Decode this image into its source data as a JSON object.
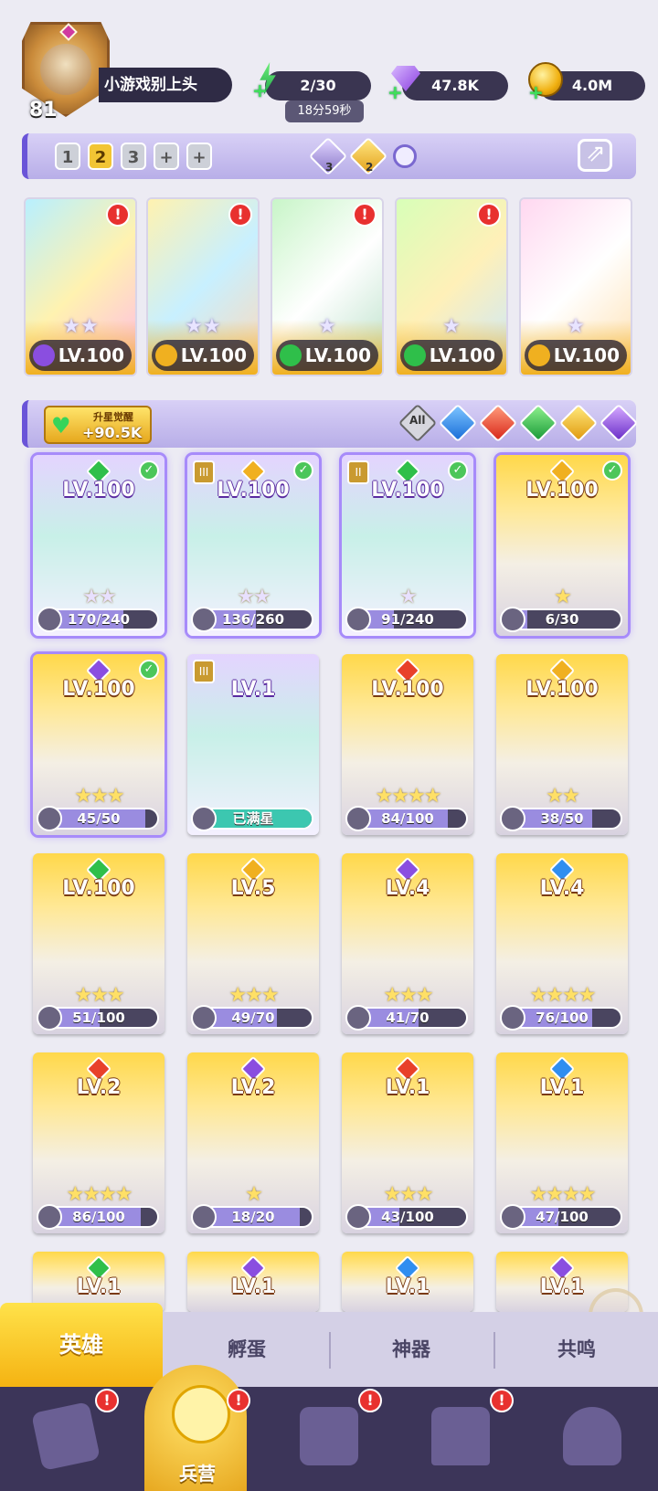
{
  "player": {
    "level": "81",
    "name": "小游戏别上头"
  },
  "resources": {
    "energy": "2/30",
    "energy_timer": "18分59秒",
    "gems": "47.8K",
    "gold": "4.0M"
  },
  "team": {
    "tabs": [
      "1",
      "2",
      "3",
      "+",
      "+"
    ],
    "active_tab": "2",
    "element_counts": [
      {
        "icon": "water-element-icon",
        "count": "3"
      },
      {
        "icon": "light-element-icon",
        "count": "2"
      }
    ],
    "members": [
      {
        "level": "LV.100",
        "element": "moon",
        "stars": 2,
        "alert": true
      },
      {
        "level": "LV.100",
        "element": "light",
        "stars": 2,
        "alert": true
      },
      {
        "level": "LV.100",
        "element": "nature",
        "stars": 1,
        "alert": true
      },
      {
        "level": "LV.100",
        "element": "nature",
        "stars": 1,
        "alert": true
      },
      {
        "level": "LV.100",
        "element": "light",
        "stars": 1,
        "alert": false
      }
    ]
  },
  "filter": {
    "awaken_title": "升星觉醒",
    "awaken_value": "+90.5K",
    "all_label": "All",
    "elements": [
      "water-element-icon",
      "fire-element-icon",
      "nature-element-icon",
      "light-element-icon",
      "moon-element-icon"
    ]
  },
  "heroes": [
    {
      "level": "LV.100",
      "progress": "170/240",
      "fill": 0.71,
      "element": "nature",
      "checked": true,
      "rank": "",
      "style": "purple",
      "stars": "★★"
    },
    {
      "level": "LV.100",
      "progress": "136/260",
      "fill": 0.52,
      "element": "light",
      "checked": true,
      "rank": "III",
      "style": "purple",
      "stars": "★★"
    },
    {
      "level": "LV.100",
      "progress": "91/240",
      "fill": 0.38,
      "element": "nature",
      "checked": true,
      "rank": "II",
      "style": "purple",
      "stars": "★"
    },
    {
      "level": "LV.100",
      "progress": "6/30",
      "fill": 0.2,
      "element": "light",
      "checked": true,
      "rank": "",
      "style": "gold",
      "stars": "★"
    },
    {
      "level": "LV.100",
      "progress": "45/50",
      "fill": 0.9,
      "element": "moon",
      "checked": true,
      "rank": "",
      "style": "gold",
      "stars": "★★★"
    },
    {
      "level": "LV.1",
      "progress": "已满星",
      "fill": 1.0,
      "element": "",
      "checked": false,
      "rank": "III",
      "style": "purple",
      "stars": ""
    },
    {
      "level": "LV.100",
      "progress": "84/100",
      "fill": 0.84,
      "element": "fire",
      "checked": false,
      "rank": "",
      "style": "gold",
      "stars": "★★★★"
    },
    {
      "level": "LV.100",
      "progress": "38/50",
      "fill": 0.76,
      "element": "light",
      "checked": false,
      "rank": "",
      "style": "gold",
      "stars": "★★"
    },
    {
      "level": "LV.100",
      "progress": "51/100",
      "fill": 0.51,
      "element": "nature",
      "checked": false,
      "rank": "",
      "style": "gold",
      "stars": "★★★"
    },
    {
      "level": "LV.5",
      "progress": "49/70",
      "fill": 0.7,
      "element": "light",
      "checked": false,
      "rank": "",
      "style": "gold",
      "stars": "★★★"
    },
    {
      "level": "LV.4",
      "progress": "41/70",
      "fill": 0.59,
      "element": "moon",
      "checked": false,
      "rank": "",
      "style": "gold",
      "stars": "★★★"
    },
    {
      "level": "LV.4",
      "progress": "76/100",
      "fill": 0.76,
      "element": "water",
      "checked": false,
      "rank": "",
      "style": "gold",
      "stars": "★★★★"
    },
    {
      "level": "LV.2",
      "progress": "86/100",
      "fill": 0.86,
      "element": "fire",
      "checked": false,
      "rank": "",
      "style": "gold",
      "stars": "★★★★"
    },
    {
      "level": "LV.2",
      "progress": "18/20",
      "fill": 0.9,
      "element": "moon",
      "checked": false,
      "rank": "",
      "style": "gold",
      "stars": "★"
    },
    {
      "level": "LV.1",
      "progress": "43/100",
      "fill": 0.43,
      "element": "fire",
      "checked": false,
      "rank": "",
      "style": "gold",
      "stars": "★★★"
    },
    {
      "level": "LV.1",
      "progress": "47/100",
      "fill": 0.47,
      "element": "water",
      "checked": false,
      "rank": "",
      "style": "gold",
      "stars": "★★★★"
    },
    {
      "level": "LV.1",
      "progress": "",
      "fill": 0,
      "element": "nature",
      "checked": false,
      "rank": "",
      "style": "gold",
      "stars": ""
    },
    {
      "level": "LV.1",
      "progress": "",
      "fill": 0,
      "element": "moon",
      "checked": false,
      "rank": "",
      "style": "gold",
      "stars": ""
    },
    {
      "level": "LV.1",
      "progress": "",
      "fill": 0,
      "element": "water",
      "checked": false,
      "rank": "",
      "style": "gold",
      "stars": ""
    },
    {
      "level": "LV.1",
      "progress": "",
      "fill": 0,
      "element": "moon",
      "checked": false,
      "rank": "",
      "style": "gold",
      "stars": ""
    }
  ],
  "sub_tabs": [
    "英雄",
    "孵蛋",
    "神器",
    "共鸣"
  ],
  "bottom_nav": [
    {
      "icon": "cards-icon",
      "label": "",
      "alert": true
    },
    {
      "icon": "barracks-icon",
      "label": "兵营",
      "alert": true,
      "active": true
    },
    {
      "icon": "map-icon",
      "label": "",
      "alert": true
    },
    {
      "icon": "castle-icon",
      "label": "",
      "alert": true
    },
    {
      "icon": "mushroom-icon",
      "label": "",
      "alert": false
    }
  ],
  "colors": {
    "water": "#2f8ef0",
    "fire": "#e8402a",
    "nature": "#2fbf4a",
    "light": "#f0b020",
    "moon": "#8a4ee0",
    "accent": "#f5c21e"
  }
}
